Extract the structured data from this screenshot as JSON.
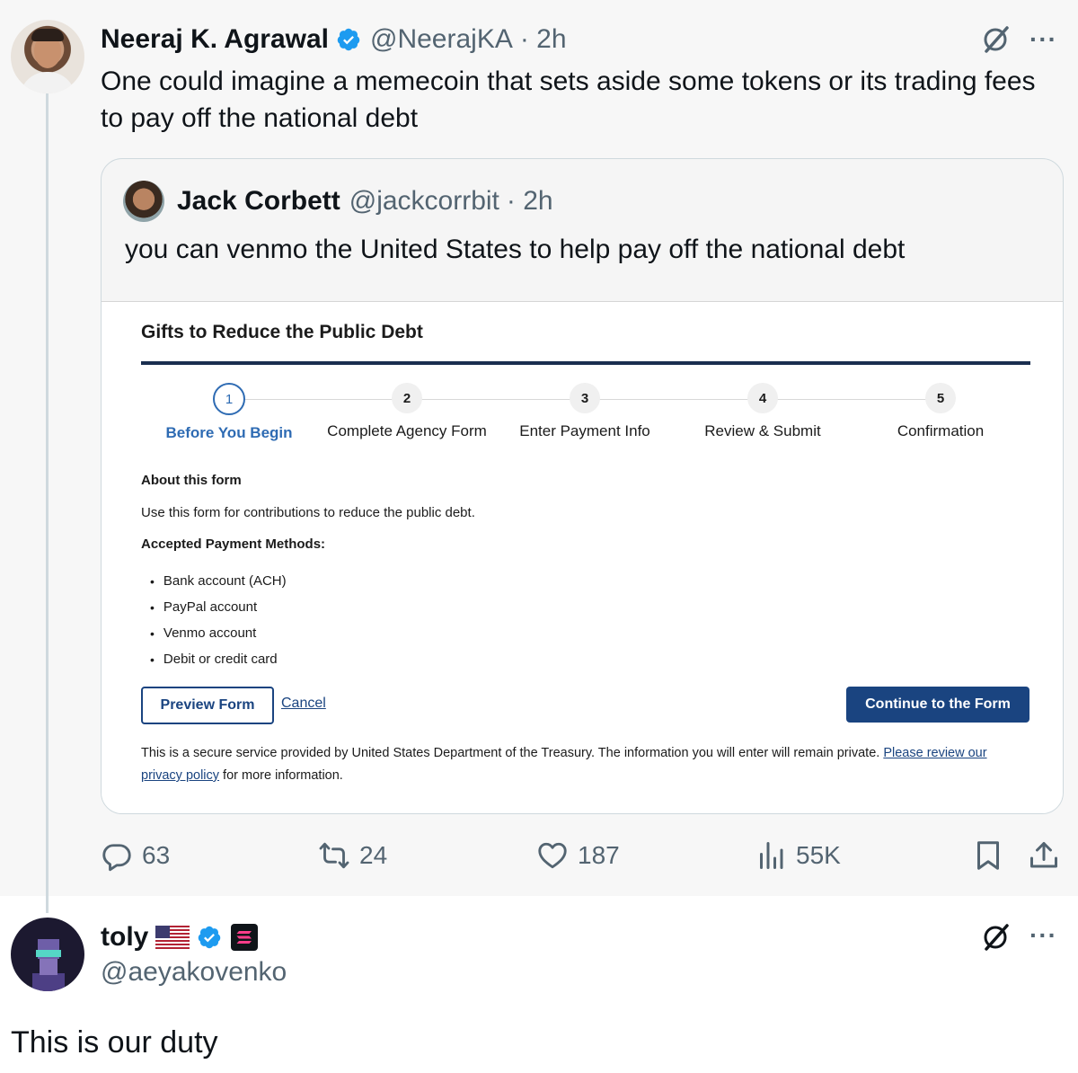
{
  "main_tweet": {
    "author_name": "Neeraj K. Agrawal",
    "handle": "@NeerajKA",
    "time": "· 2h",
    "text": "One could imagine a memecoin that sets aside some tokens or its trading fees to pay off the national debt",
    "more_label": "···",
    "quoted_tweet": {
      "author_name": "Jack Corbett",
      "handle": "@jackcorrbit",
      "time": "· 2h",
      "text": "you can venmo the United States to help pay off the national debt",
      "form": {
        "title": "Gifts to Reduce the Public Debt",
        "steps": [
          {
            "number": "1",
            "label": "Before You Begin"
          },
          {
            "number": "2",
            "label": "Complete Agency Form"
          },
          {
            "number": "3",
            "label": "Enter Payment Info"
          },
          {
            "number": "4",
            "label": "Review & Submit"
          },
          {
            "number": "5",
            "label": "Confirmation"
          }
        ],
        "about_heading": "About this form",
        "about_text": "Use this form for contributions to reduce the public debt.",
        "methods_heading": "Accepted Payment Methods:",
        "methods": [
          "Bank account (ACH)",
          "PayPal account",
          "Venmo account",
          "Debit or credit card"
        ],
        "preview_button": "Preview Form",
        "cancel_link": "Cancel",
        "continue_button": "Continue to the Form",
        "notice_text": "This is a secure service provided by United States Department of the Treasury. The information you will enter will remain private. ",
        "notice_link": "Please review our privacy policy",
        "notice_suffix": " for more information."
      }
    },
    "metrics": {
      "replies": "63",
      "retweets": "24",
      "likes": "187",
      "views": "55K"
    }
  },
  "reply_tweet": {
    "author_name": "toly",
    "handle": "@aeyakovenko",
    "text": "This is our duty",
    "more_label": "···"
  },
  "colors": {
    "verified": "#1d9bf0",
    "form_blue": "#1a4480",
    "step_active": "#2e6bb3",
    "muted": "#536471"
  }
}
